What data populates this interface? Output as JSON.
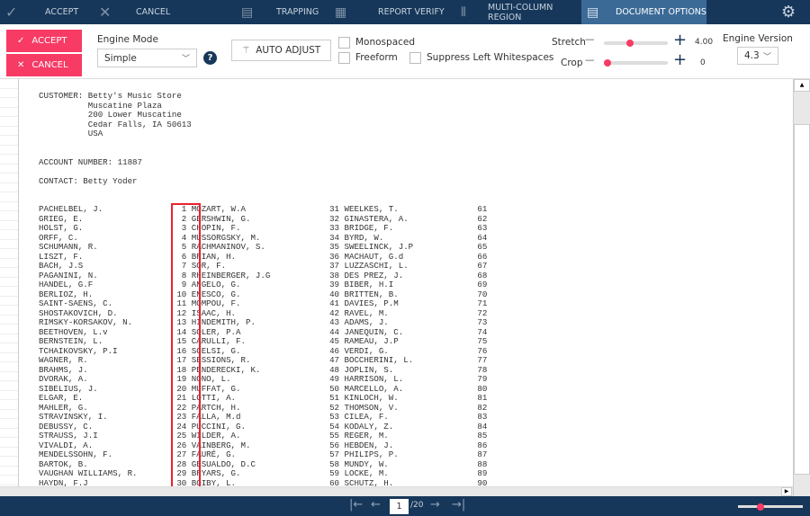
{
  "topbar": {
    "accept": "ACCEPT",
    "cancel": "CANCEL",
    "trapping": "TRAPPING",
    "report_verify": "REPORT VERIFY",
    "multi_column": "MULTI-COLUMN REGION",
    "document_options": "DOCUMENT OPTIONS"
  },
  "toolbar": {
    "accept": "ACCEPT",
    "cancel": "CANCEL",
    "engine_mode_label": "Engine Mode",
    "engine_mode_value": "Simple",
    "auto_adjust": "AUTO ADJUST",
    "monospaced": "Monospaced",
    "freeform": "Freeform",
    "suppress": "Suppress Left Whitespaces",
    "stretch_label": "Stretch",
    "stretch_value": "4.00",
    "stretch_fraction": 0.4,
    "crop_label": "Crop",
    "crop_value": "0",
    "crop_fraction": 0.0,
    "engine_version_label": "Engine Version",
    "engine_version_value": "4.3"
  },
  "document": {
    "header_lines": [
      "CUSTOMER: Betty's Music Store",
      "          Muscatine Plaza",
      "          200 Lower Muscatine",
      "          Cedar Falls, IA 50613",
      "          USA",
      "",
      "",
      "ACCOUNT NUMBER: 11887",
      "",
      "CONTACT: Betty Yoder",
      "",
      ""
    ],
    "rows": [
      [
        "PACHELBEL, J.",
        "1",
        "MOZART, W.A",
        "31",
        "WEELKES, T.",
        "61"
      ],
      [
        "GRIEG, E.",
        "2",
        "GERSHWIN, G.",
        "32",
        "GINASTERA, A.",
        "62"
      ],
      [
        "HOLST, G.",
        "3",
        "CHOPIN, F.",
        "33",
        "BRIDGE, F.",
        "63"
      ],
      [
        "ORFF, C.",
        "4",
        "MUSSORGSKY, M.",
        "34",
        "BYRD, W.",
        "64"
      ],
      [
        "SCHUMANN, R.",
        "5",
        "RACHMANINOV, S.",
        "35",
        "SWEELINCK, J.P",
        "65"
      ],
      [
        "LISZT, F.",
        "6",
        "BRIAN, H.",
        "36",
        "MACHAUT, G.d",
        "66"
      ],
      [
        "BACH, J.S",
        "7",
        "SOR, F.",
        "37",
        "LUZZASCHI, L.",
        "67"
      ],
      [
        "PAGANINI, N.",
        "8",
        "RHEINBERGER, J.G",
        "38",
        "DES PREZ, J.",
        "68"
      ],
      [
        "HANDEL, G.F",
        "9",
        "ANGELO, G.",
        "39",
        "BIBER, H.I",
        "69"
      ],
      [
        "BERLIOZ, H.",
        "10",
        "ENESCO, G.",
        "40",
        "BRITTEN, B.",
        "70"
      ],
      [
        "SAINT-SAENS, C.",
        "11",
        "MOMPOU, F.",
        "41",
        "DAVIES, P.M",
        "71"
      ],
      [
        "SHOSTAKOVICH, D.",
        "12",
        "ISAAC, H.",
        "42",
        "RAVEL, M.",
        "72"
      ],
      [
        "RIMSKY-KORSAKOV, N.",
        "13",
        "HINDEMITH, P.",
        "43",
        "ADAMS, J.",
        "73"
      ],
      [
        "BEETHOVEN, L.v",
        "14",
        "SOLER, P.A",
        "44",
        "JANEQUIN, C.",
        "74"
      ],
      [
        "BERNSTEIN, L.",
        "15",
        "CARULLI, F.",
        "45",
        "RAMEAU, J.P",
        "75"
      ],
      [
        "TCHAIKOVSKY, P.I",
        "16",
        "SCELSI, G.",
        "46",
        "VERDI, G.",
        "76"
      ],
      [
        "WAGNER, R.",
        "17",
        "SESSIONS, R.",
        "47",
        "BOCCHERINI, L.",
        "77"
      ],
      [
        "BRAHMS, J.",
        "18",
        "PENDERECKI, K.",
        "48",
        "JOPLIN, S.",
        "78"
      ],
      [
        "DVORAK, A.",
        "19",
        "NONO, L.",
        "49",
        "HARRISON, L.",
        "79"
      ],
      [
        "SIBELIUS, J.",
        "20",
        "MUFFAT, G.",
        "50",
        "MARCELLO, A.",
        "80"
      ],
      [
        "ELGAR, E.",
        "21",
        "LOTTI, A.",
        "51",
        "KINLOCH, W.",
        "81"
      ],
      [
        "MAHLER, G.",
        "22",
        "PARTCH, H.",
        "52",
        "THOMSON, V.",
        "82"
      ],
      [
        "STRAVINSKY, I.",
        "23",
        "FALLA, M.d",
        "53",
        "CILEA, F.",
        "83"
      ],
      [
        "DEBUSSY, C.",
        "24",
        "PUCCINI, G.",
        "54",
        "KODALY, Z.",
        "84"
      ],
      [
        "STRAUSS, J.I",
        "25",
        "WILDER, A.",
        "55",
        "REGER, M.",
        "85"
      ],
      [
        "VIVALDI, A.",
        "26",
        "VAINBERG, M.",
        "56",
        "HEBDEN, J.",
        "86"
      ],
      [
        "MENDELSSOHN, F.",
        "27",
        "FAURÉ, G.",
        "57",
        "PHILIPS, P.",
        "87"
      ],
      [
        "BARTOK, B.",
        "28",
        "GESUALDO, D.C",
        "58",
        "MUNDY, W.",
        "88"
      ],
      [
        "VAUGHAN WILLIAMS, R.",
        "29",
        "BRYARS, G.",
        "59",
        "LOCKE, M.",
        "89"
      ],
      [
        "HAYDN, F.J",
        "30",
        "BOIBY, L.",
        "60",
        "SCHUTZ, H.",
        "90"
      ]
    ]
  },
  "pager": {
    "current_page": "1",
    "total": "/20",
    "zoom_fraction": 0.33
  },
  "colors": {
    "accent": "#f73b65",
    "nav": "#17375a",
    "active_tab": "#3b6a97",
    "highlight": "#e8232e"
  }
}
